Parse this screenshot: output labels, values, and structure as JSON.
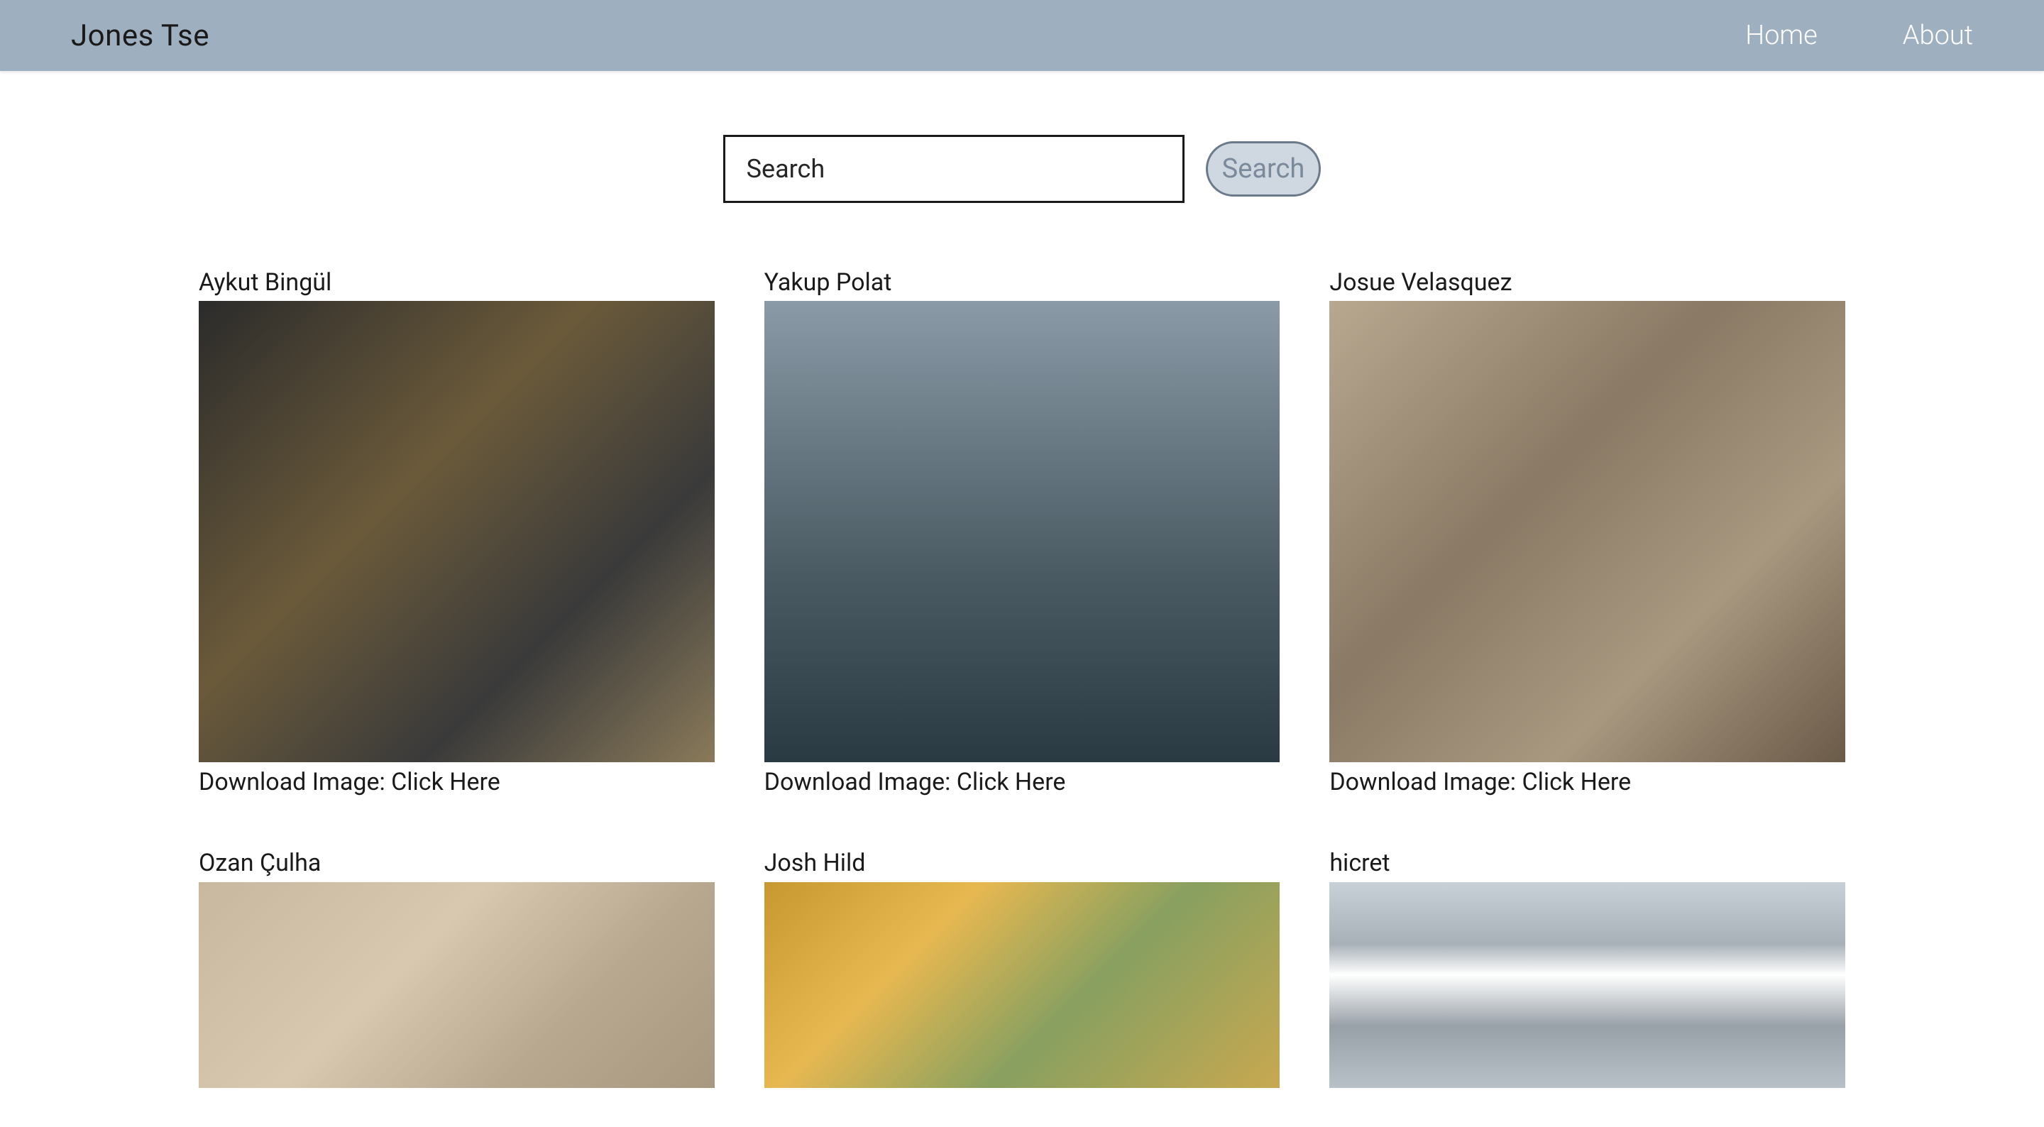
{
  "nav": {
    "brand": "Jones Tse",
    "home": "Home",
    "about": "About"
  },
  "search": {
    "placeholder": "Search",
    "button_label": "Search"
  },
  "gallery": {
    "download_prefix": "Download Image: ",
    "download_link_text": "Click Here",
    "items": [
      {
        "author": "Aykut Bingül"
      },
      {
        "author": "Yakup Polat"
      },
      {
        "author": "Josue Velasquez"
      },
      {
        "author": "Ozan Çulha"
      },
      {
        "author": "Josh Hild"
      },
      {
        "author": "hicret"
      }
    ]
  }
}
